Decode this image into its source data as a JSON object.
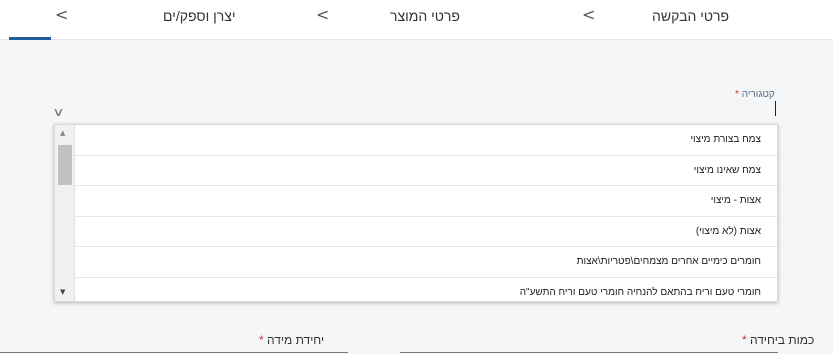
{
  "steps": [
    {
      "label": "פרטי הבקשה",
      "chevron": "<"
    },
    {
      "label": "פרטי המוצר",
      "chevron": "<"
    },
    {
      "label": "יצרן וספק/ים",
      "chevron": "<"
    }
  ],
  "category": {
    "label": "קטגוריה",
    "required_mark": "*",
    "arrow": "∨"
  },
  "dropdown": {
    "options": [
      "צמח בצורת מיצוי",
      "צמח שאינו מיצוי",
      "אצות - מיצוי",
      "אצות (לא מיצוי)",
      "חומרים כימיים אחרים מצמחים\\פטריות\\אצות",
      "חומרי טעם וריח בהתאם להנחיה חומרי טעם וריח התשע\"ה"
    ],
    "scroll_up": "▲",
    "scroll_down": "▼"
  },
  "quantity": {
    "label": "כמות ביחידה",
    "required_mark": "*"
  },
  "unit": {
    "label": "יחידת מידה",
    "required_mark": "*"
  },
  "colors": {
    "accent": "#1f5f97",
    "required": "#d12e2e"
  }
}
